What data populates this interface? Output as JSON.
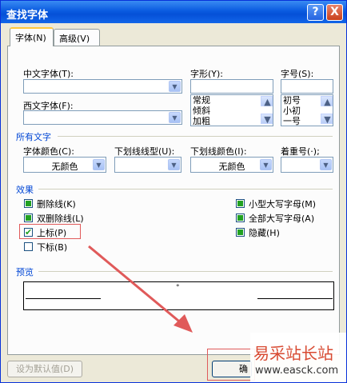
{
  "window": {
    "title": "查找字体",
    "help_label": "?",
    "close_label": "X"
  },
  "tabs": [
    {
      "label": "字体(N)",
      "active": true
    },
    {
      "label": "高级(V)",
      "active": false
    }
  ],
  "font": {
    "chinese_label": "中文字体(T):",
    "western_label": "西文字体(F):",
    "style_label": "字形(Y):",
    "size_label": "字号(S):",
    "style_options": [
      "常规",
      "倾斜",
      "加粗"
    ],
    "size_options": [
      "初号",
      "小初",
      "一号"
    ]
  },
  "all_text": {
    "group_label": "所有文字",
    "color_label": "字体颜色(C):",
    "color_value": "无颜色",
    "underline_label": "下划线线型(U):",
    "underline_color_label": "下划线颜色(I):",
    "underline_color_value": "无颜色",
    "emphasis_label": "着重号(·);"
  },
  "effects": {
    "group_label": "效果",
    "items": [
      {
        "label": "删除线(K)",
        "state": "indeterminate"
      },
      {
        "label": "双删除线(L)",
        "state": "indeterminate"
      },
      {
        "label": "上标(P)",
        "state": "checked"
      },
      {
        "label": "下标(B)",
        "state": "unchecked"
      },
      {
        "label": "小型大写字母(M)",
        "state": "indeterminate"
      },
      {
        "label": "全部大写字母(A)",
        "state": "indeterminate"
      },
      {
        "label": "隐藏(H)",
        "state": "indeterminate"
      }
    ]
  },
  "preview": {
    "group_label": "预览",
    "text": "°"
  },
  "buttons": {
    "default_label": "设为默认值(D)",
    "ok_label": "确"
  },
  "watermark": {
    "title": "易采站长站",
    "url": "www.easck.com"
  },
  "colors": {
    "accent": "#0046d5",
    "annotation": "#e05a5a",
    "titlebar": "#0a5be0"
  }
}
